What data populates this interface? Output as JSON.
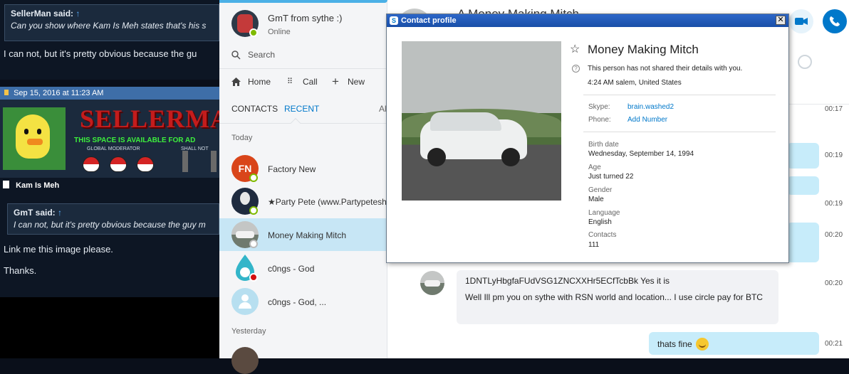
{
  "forum": {
    "quote1_author": "SellerMan said:",
    "quote1_arrow": "↑",
    "quote1_text": "Can you show where Kam Is Meh states that's his s",
    "reply1": "I can not, but it's pretty obvious because the gu",
    "post_date": "Sep 15, 2016 at 11:23 AM",
    "sig_title": "SELLERMAN",
    "sig_line": "THIS SPACE IS AVAILABLE FOR AD",
    "sig_small_left": "GLOBAL MODERATOR",
    "sig_small_right": "SHALL NOT",
    "thread_title": "Kam Is Meh",
    "quote2_author": "GmT said:",
    "quote2_arrow": "↑",
    "quote2_text": "I can not, but it's pretty obvious because the guy m",
    "reply2_line1": "Link me this image please.",
    "reply2_line2": "Thanks."
  },
  "skype": {
    "profile_name": "GmT from sythe :)",
    "profile_status": "Online",
    "search_placeholder": "Search",
    "nav_home": "Home",
    "nav_call": "Call",
    "nav_new": "New",
    "tab_contacts": "CONTACTS",
    "tab_recent": "RECENT",
    "tab_all": "Al",
    "section_today": "Today",
    "section_yesterday": "Yesterday",
    "contacts": [
      {
        "name": "Factory New",
        "initials": "FN"
      },
      {
        "name": "★Party Pete (www.Partypetesh"
      },
      {
        "name": "Money Making Mitch"
      },
      {
        "name": "c0ngs - God"
      },
      {
        "name": "c0ngs - God, ..."
      }
    ],
    "chat_header_name": "A Money Making Mitch",
    "times": [
      "00:17",
      "00:19",
      "00:19",
      "00:20",
      "00:20",
      "00:21"
    ],
    "msg_in_1": "1DNTLyHbgfaFUdVSG1ZNCXXHr5ECfTcbBk Yes it is",
    "msg_in_2": "Well Ill pm you on sythe with RSN world and location... I use circle pay for BTC",
    "msg_out_last": "thats fine"
  },
  "dialog": {
    "title": "Contact profile",
    "close": "✕",
    "name": "Money Making Mitch",
    "notice": "This person has not shared their details with you.",
    "location": "4:24 AM salem, United States",
    "skype_label": "Skype:",
    "skype_value": "brain.washed2",
    "phone_label": "Phone:",
    "phone_value": "Add Number",
    "birth_label": "Birth date",
    "birth_value": "Wednesday, September 14, 1994",
    "age_label": "Age",
    "age_value": "Just turned 22",
    "gender_label": "Gender",
    "gender_value": "Male",
    "language_label": "Language",
    "language_value": "English",
    "contacts_label": "Contacts",
    "contacts_value": "111"
  },
  "colors": {
    "skype_blue": "#0078ca",
    "accent_blue": "#00aff0",
    "online_green": "#7fba00",
    "dnd_red": "#d40e0e",
    "selected_row": "#c7e6f5"
  }
}
